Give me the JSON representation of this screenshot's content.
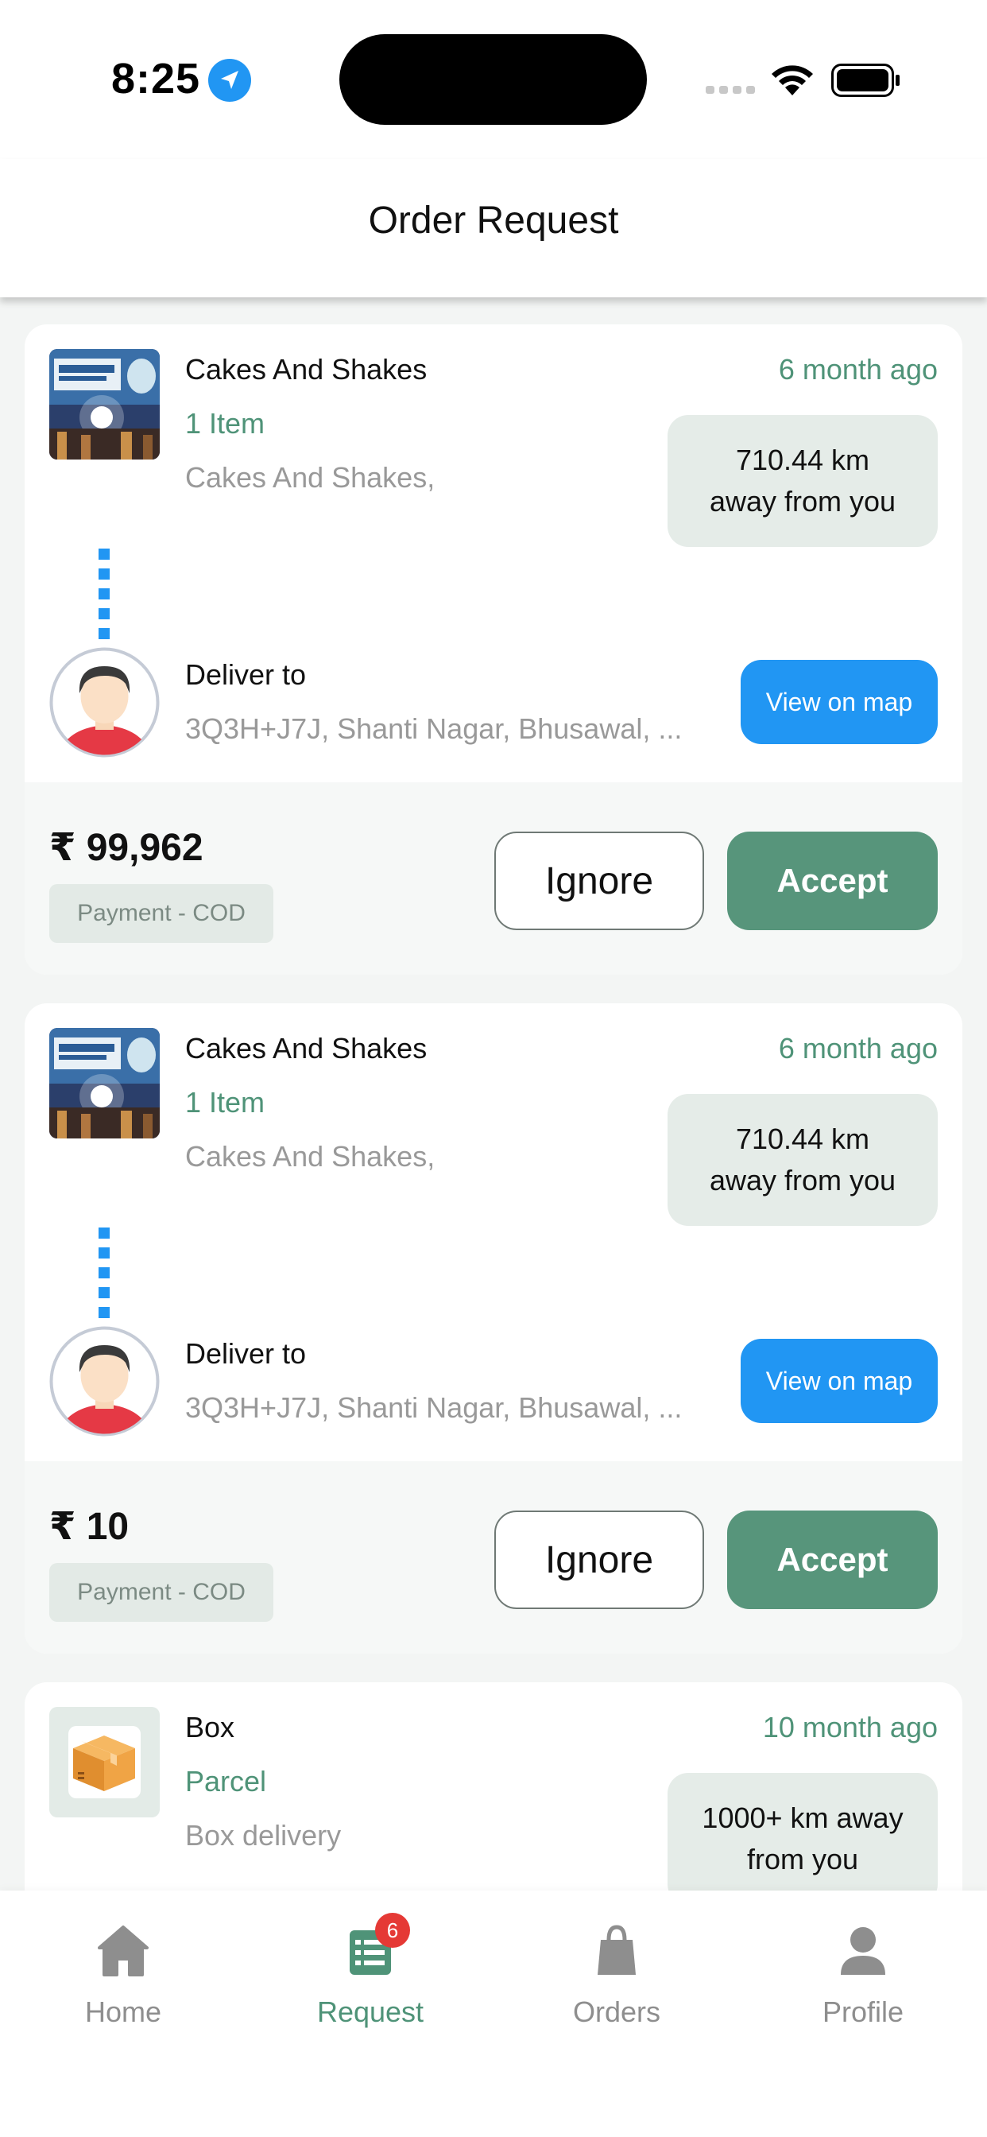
{
  "status_bar": {
    "time": "8:25",
    "location_icon": "location-arrow-icon",
    "signal_icon": "cellular-signal-icon",
    "wifi_icon": "wifi-icon",
    "battery_icon": "battery-icon"
  },
  "header": {
    "title": "Order Request"
  },
  "orders": [
    {
      "store_name": "Cakes And Shakes",
      "item_count": "1 Item",
      "store_address": "Cakes And Shakes,",
      "time_ago": "6 month ago",
      "distance_line1": "710.44 km",
      "distance_line2": "away from you",
      "deliver_label": "Deliver to",
      "deliver_address": "3Q3H+J7J, Shanti Nagar, Bhusawal, ...",
      "map_button": "View on map",
      "price": "₹ 99,962",
      "payment": "Payment - COD",
      "ignore_button": "Ignore",
      "accept_button": "Accept"
    },
    {
      "store_name": "Cakes And Shakes",
      "item_count": "1 Item",
      "store_address": "Cakes And Shakes,",
      "time_ago": "6 month ago",
      "distance_line1": "710.44 km",
      "distance_line2": "away from you",
      "deliver_label": "Deliver to",
      "deliver_address": "3Q3H+J7J, Shanti Nagar, Bhusawal, ...",
      "map_button": "View on map",
      "price": "₹ 10",
      "payment": "Payment - COD",
      "ignore_button": "Ignore",
      "accept_button": "Accept"
    },
    {
      "store_name": "Box",
      "item_count": "Parcel",
      "store_address": "Box delivery",
      "time_ago": "10 month ago",
      "distance_line1": "1000+ km away",
      "distance_line2": "from you"
    }
  ],
  "nav": {
    "home": "Home",
    "request": "Request",
    "request_badge": "6",
    "orders": "Orders",
    "profile": "Profile"
  },
  "colors": {
    "accent_green": "#57957b",
    "text_green": "#4f9378",
    "map_blue": "#2196f3",
    "badge_red": "#e53935"
  }
}
